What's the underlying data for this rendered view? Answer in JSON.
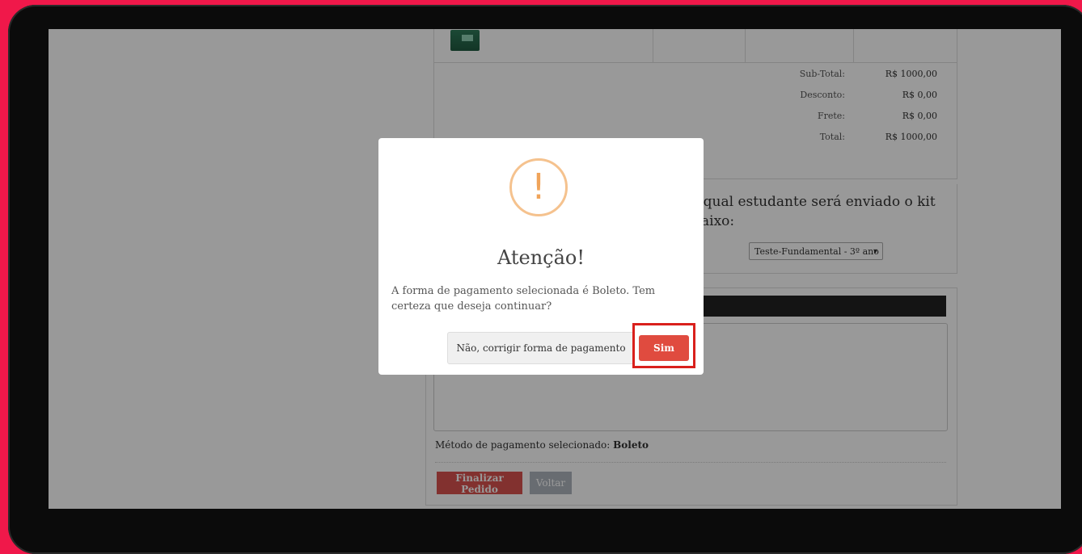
{
  "order": {
    "totals": [
      {
        "label": "Sub-Total:",
        "value": "R$ 1000,00"
      },
      {
        "label": "Desconto:",
        "value": "R$ 0,00"
      },
      {
        "label": "Frete:",
        "value": "R$ 0,00"
      },
      {
        "label": "Total:",
        "value": "R$ 1000,00"
      }
    ]
  },
  "student": {
    "question_line1": "ra qual estudante será enviado o kit",
    "question_line2": "abaixo:",
    "selected": "Teste-Fundamental - 3º ano"
  },
  "payment": {
    "method_label": "Método de pagamento selecionado:",
    "method_value": "Boleto",
    "finalize_label": "Finalizar Pedido",
    "back_label": "Voltar"
  },
  "dialog": {
    "icon": "!",
    "title": "Atenção!",
    "message": "A forma de pagamento selecionada é Boleto. Tem certeza que deseja continuar?",
    "cancel_label": "Não, corrigir forma de pagamento",
    "confirm_label": "Sim"
  },
  "colors": {
    "background": "#f0184a",
    "warning": "#f0a45a",
    "confirm": "#e04b3f",
    "highlight": "#d9201c"
  }
}
